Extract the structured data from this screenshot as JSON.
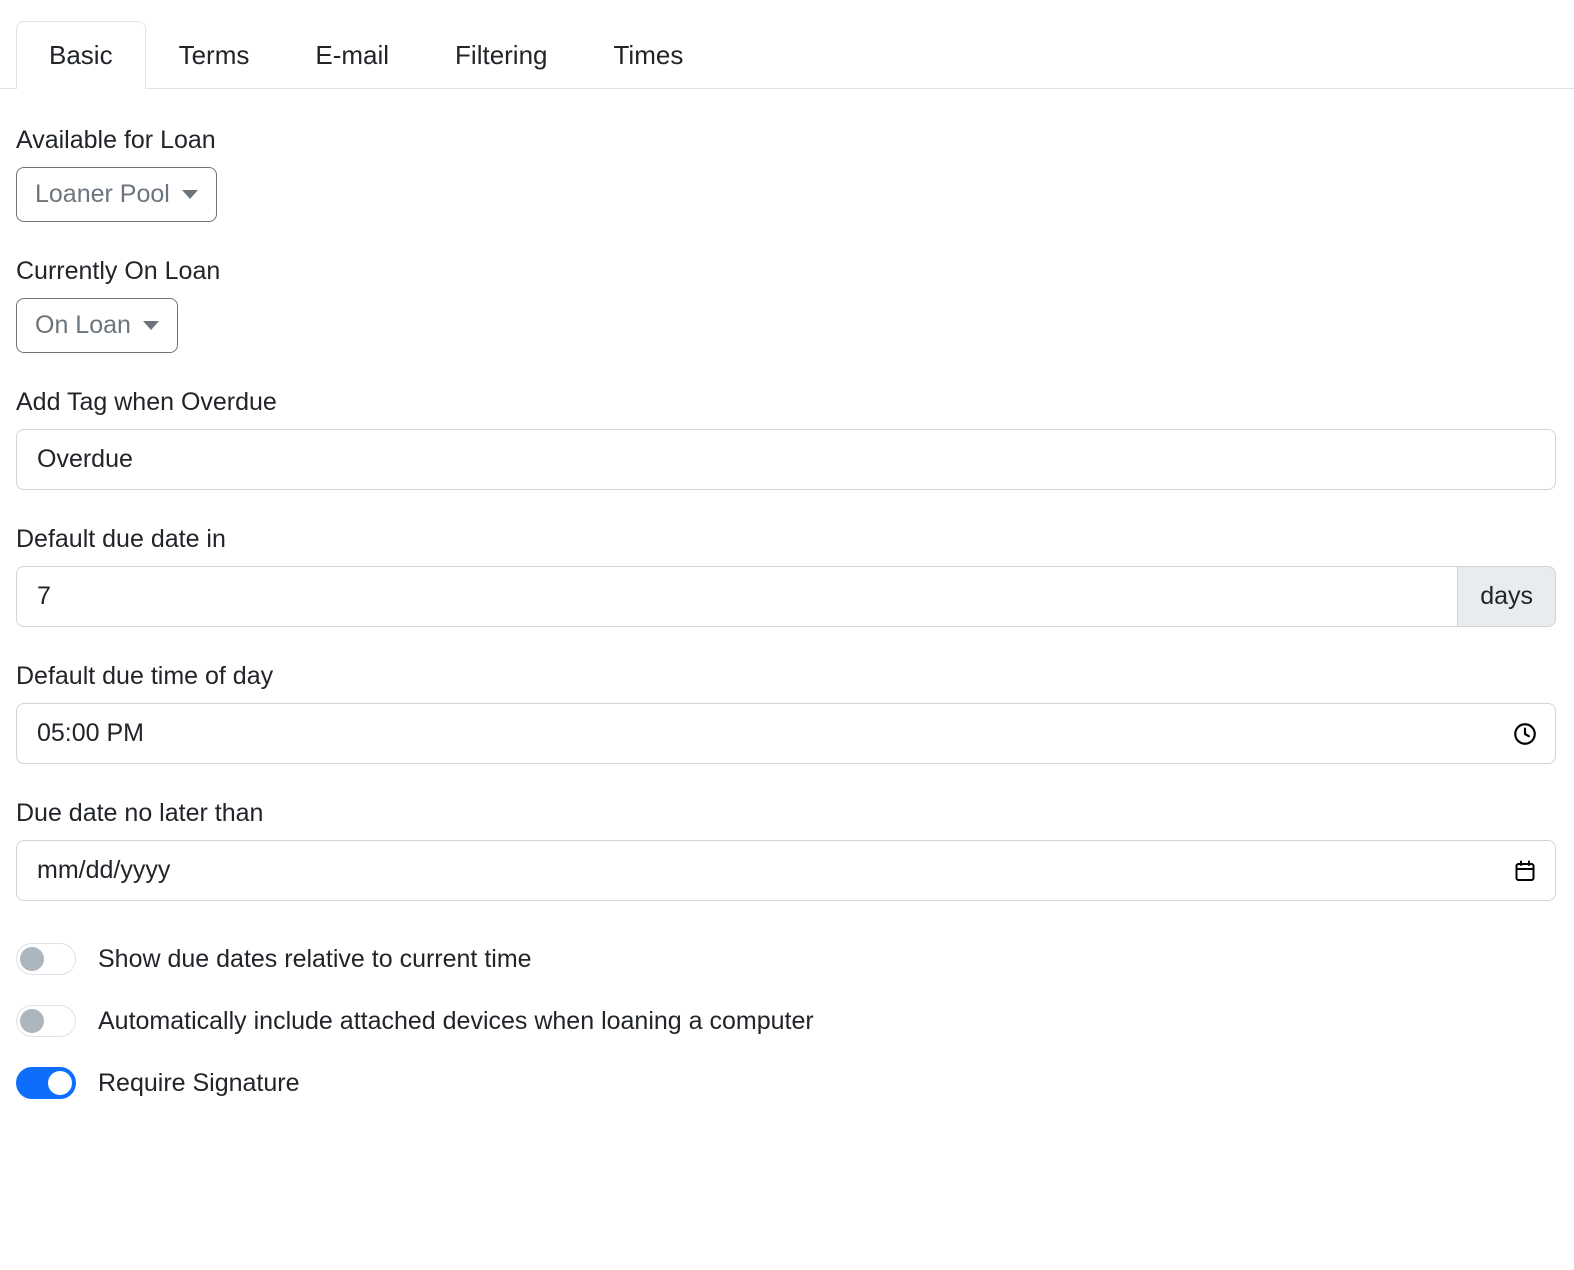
{
  "tabs": [
    {
      "label": "Basic",
      "active": true
    },
    {
      "label": "Terms",
      "active": false
    },
    {
      "label": "E-mail",
      "active": false
    },
    {
      "label": "Filtering",
      "active": false
    },
    {
      "label": "Times",
      "active": false
    }
  ],
  "fields": {
    "available_for_loan": {
      "label": "Available for Loan",
      "dropdown_value": "Loaner Pool"
    },
    "currently_on_loan": {
      "label": "Currently On Loan",
      "dropdown_value": "On Loan"
    },
    "overdue_tag": {
      "label": "Add Tag when Overdue",
      "value": "Overdue"
    },
    "default_due_date_in": {
      "label": "Default due date in",
      "value": "7",
      "unit": "days"
    },
    "default_due_time": {
      "label": "Default due time of day",
      "value": "05:00 PM",
      "icon": "clock-icon"
    },
    "due_date_no_later_than": {
      "label": "Due date no later than",
      "value": "",
      "placeholder": "mm/dd/yyyy",
      "icon": "calendar-icon"
    }
  },
  "switches": [
    {
      "label": "Show due dates relative to current time",
      "on": false
    },
    {
      "label": "Automatically include attached devices when loaning a computer",
      "on": false
    },
    {
      "label": "Require Signature",
      "on": true
    }
  ],
  "colors": {
    "accent": "#0d6efd",
    "border": "#ced4da",
    "muted_text": "#6c757d",
    "addon_bg": "#e9ecef"
  }
}
